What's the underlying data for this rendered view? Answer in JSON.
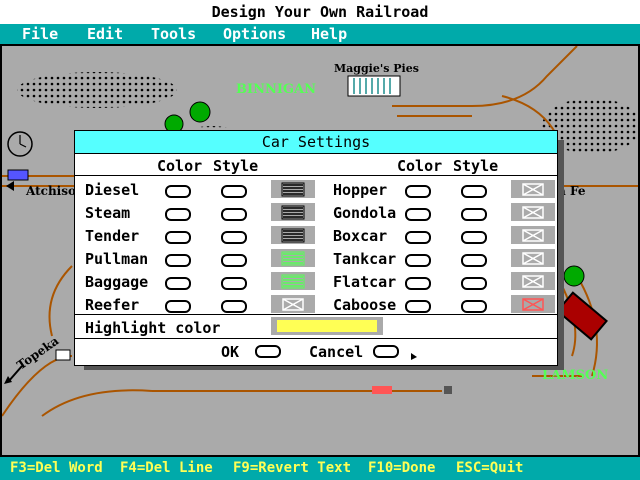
{
  "app": {
    "title": "Design Your Own Railroad"
  },
  "menu": {
    "items": [
      "File",
      "Edit",
      "Tools",
      "Options",
      "Help"
    ]
  },
  "map_labels": {
    "binnigan": "BINNIGAN",
    "maggies": "Maggie's Pies",
    "atchison": "Atchiso",
    "santa_fe": "a Fe",
    "topeka": "Topeka",
    "lamson": "LAMSON"
  },
  "dialog": {
    "title": "Car Settings",
    "col_color": "Color",
    "col_style": "Style",
    "left_cars": [
      {
        "name": "Diesel",
        "swatch": "dark-lines"
      },
      {
        "name": "Steam",
        "swatch": "dark-lines"
      },
      {
        "name": "Tender",
        "swatch": "dark-lines"
      },
      {
        "name": "Pullman",
        "swatch": "green-lines"
      },
      {
        "name": "Baggage",
        "swatch": "green-lines"
      },
      {
        "name": "Reefer",
        "swatch": "white-x"
      }
    ],
    "right_cars": [
      {
        "name": "Hopper",
        "swatch": "white-x"
      },
      {
        "name": "Gondola",
        "swatch": "white-x"
      },
      {
        "name": "Boxcar",
        "swatch": "white-x"
      },
      {
        "name": "Tankcar",
        "swatch": "white-x"
      },
      {
        "name": "Flatcar",
        "swatch": "white-x"
      },
      {
        "name": "Caboose",
        "swatch": "red-x"
      }
    ],
    "highlight_label": "Highlight color",
    "highlight_color": "#ffff55",
    "ok_label": "OK",
    "cancel_label": "Cancel"
  },
  "status": {
    "items": [
      "F3=Del Word",
      "F4=Del Line",
      "F9=Revert Text",
      "F10=Done",
      "ESC=Quit"
    ]
  },
  "colors": {
    "menu_bg": "#00aaaa",
    "map_bg": "#aaaaaa",
    "track": "#aa5500",
    "title_bar": "#55ffff",
    "status_text": "#ffff55",
    "town_label": "#55ff55"
  }
}
